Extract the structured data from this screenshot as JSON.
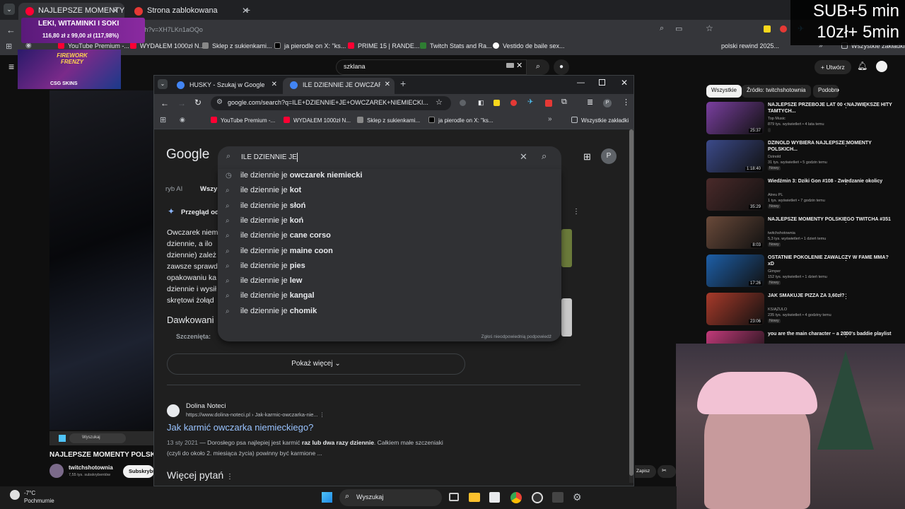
{
  "outer_browser": {
    "tabs": [
      {
        "label": "NAJLEPSZE MOMENTY POLSKIE",
        "color": "#ff0033",
        "active": true
      },
      {
        "label": "Strona zablokowana",
        "color": "#e53935",
        "active": false
      }
    ],
    "url": "youtube.com/watch?v=XH7LKn1aOQo",
    "bookmarks": [
      "YouTube Premium -...",
      "WYDAŁEM 1000zł N...",
      "Sklep z sukienkami...",
      "ja pierodle on X: \"ks...",
      "PRIME 15 | RANDE...",
      "Twitch Stats and Ra...",
      "Vestido de baile sex...",
      "polski rewind 2025...",
      "Wszystkie zakładki"
    ]
  },
  "overlay": {
    "sub_line1": "SUB+5 min",
    "sub_line2": "10zł+ 5min",
    "promo_title": "LEKI, WITAMINKI I SOKI",
    "promo_amount": "116,80 zł z 99,00 zł (117,98%)",
    "promo_progress": 1.0,
    "firework_title": "FIREWORK FRENZY",
    "csg_label": "CSG SKINS"
  },
  "youtube": {
    "search_value": "szklana",
    "create_label": "Utwórz",
    "video_title": "NAJLEPSZE MOMENTY POLSKIE",
    "channel": "twitchshotownia",
    "subs": "7,55 tys. subskrybentów",
    "subscribe_label": "Subskrybuj",
    "mini_search": "Wyszukaj",
    "save_label": "Zapisz",
    "chips": [
      "Wszystkie",
      "Źródło: twitchshotownia",
      "Podobne"
    ],
    "recommendations": [
      {
        "title": "NAJLEPSZE PRZEBOJE LAT 00 • NAJWIĘKSZE HITY TAMTYCH...",
        "channel": "Top Music",
        "meta": "879 tys. wyświetleń • 4 lata temu",
        "duration": "25:37",
        "badge": "",
        "color": "#7a3fa0"
      },
      {
        "title": "DZINOLD WYBIERA NAJLEPSZE MOMENTY POLSKICH...",
        "channel": "Dzinold",
        "meta": "31 tys. wyświetleń • 5 godzin temu",
        "duration": "1:18:40",
        "badge": "Nowy",
        "color": "#3b4a8a"
      },
      {
        "title": "Wiedźmin 3: Dziki Gon #108 - Zwiedzanie okolicy",
        "channel": "Atreu PL",
        "meta": "1 tys. wyświetleń • 7 godzin temu",
        "duration": "35:29",
        "badge": "Nowy",
        "color": "#4a2a2a"
      },
      {
        "title": "NAJLEPSZE MOMENTY POLSKIEGO TWITCHA #351",
        "channel": "twitchshotownia",
        "meta": "5,3 tys. wyświetleń • 1 dzień temu",
        "duration": "8:03",
        "badge": "Nowy",
        "color": "#6a4a3a"
      },
      {
        "title": "OSTATNIE POKOLENIE ZAWALCZY W FAME MMA? xD",
        "channel": "Gimper",
        "meta": "152 tys. wyświetleń • 1 dzień temu",
        "duration": "17:26",
        "badge": "Nowy",
        "color": "#1d5fa8"
      },
      {
        "title": "JAK SMAKUJE PIZZA ZA 3,60zł?",
        "channel": "KSIĄŻULO",
        "meta": "235 tys. wyświetleń • 4 godziny temu",
        "duration": "23:06",
        "badge": "Nowy",
        "color": "#a83a2a"
      },
      {
        "title": "you are the main character – a 2000's baddie playlist",
        "channel": "",
        "meta": "",
        "duration": "",
        "badge": "",
        "color": "#c23a7a"
      }
    ]
  },
  "inner_browser": {
    "tabs": [
      "HUSKY - Szukaj w Google",
      "ILE DZIENNIE JE OWCZAREK NI..."
    ],
    "url": "google.com/search?q=ILE+DZIENNIE+JE+OWCZAREK+NIEMIECKI...",
    "bookmarks": [
      "YouTube Premium -...",
      "WYDAŁEM 1000zł N...",
      "Sklep z sukienkami...",
      "ja pierodle on X: \"ks...",
      "Wszystkie zakładki"
    ]
  },
  "google": {
    "logo": "Google",
    "query": "ILE DZIENNIE JE",
    "tabs_partial": [
      "ryb AI",
      "Wszys"
    ],
    "ai_overview": "Przegląd od",
    "snippet_lines": [
      "Owczarek niem",
      "dziennie, a ilo",
      "dziennie) zależ",
      "zawsze sprawd",
      "opakowaniu ka",
      "dziennie i wysił",
      "skrętowi żołąd"
    ],
    "dosing_heading": "Dawkowani",
    "dosing_item": "Szczenięta:",
    "suggestion_prefix": "ile dziennie je",
    "suggestions": [
      {
        "bold": "owczarek niemiecki",
        "icon": "history"
      },
      {
        "bold": "kot",
        "icon": "search"
      },
      {
        "bold": "słoń",
        "icon": "search"
      },
      {
        "bold": "koń",
        "icon": "search"
      },
      {
        "bold": "cane corso",
        "icon": "search"
      },
      {
        "bold": "maine coon",
        "icon": "search"
      },
      {
        "bold": "pies",
        "icon": "search"
      },
      {
        "bold": "lew",
        "icon": "search"
      },
      {
        "bold": "kangal",
        "icon": "search"
      },
      {
        "bold": "chomik",
        "icon": "search"
      }
    ],
    "report_label": "Zgłoś nieodpowiednią podpowiedź",
    "show_more": "Pokaż więcej",
    "result": {
      "site": "Dolina Noteci",
      "url": "https://www.dolina-noteci.pl › Jak-karmic-owczarka-nie...",
      "title": "Jak karmić owczarka niemieckiego?",
      "date": "13 sty 2021",
      "snippet_pre": " — Dorosłego psa najlepiej jest karmić ",
      "snippet_bold": "raz lub dwa razy dziennie",
      "snippet_post": ". Całkiem małe szczeniaki",
      "snippet_line2": "(czyli do około 2. miesiąca życia) powinny być karmione ..."
    },
    "more_questions": "Więcej pytań"
  },
  "taskbar": {
    "weather_temp": "-7°C",
    "weather_desc": "Pochmurnie",
    "search_label": "Wyszukaj"
  }
}
